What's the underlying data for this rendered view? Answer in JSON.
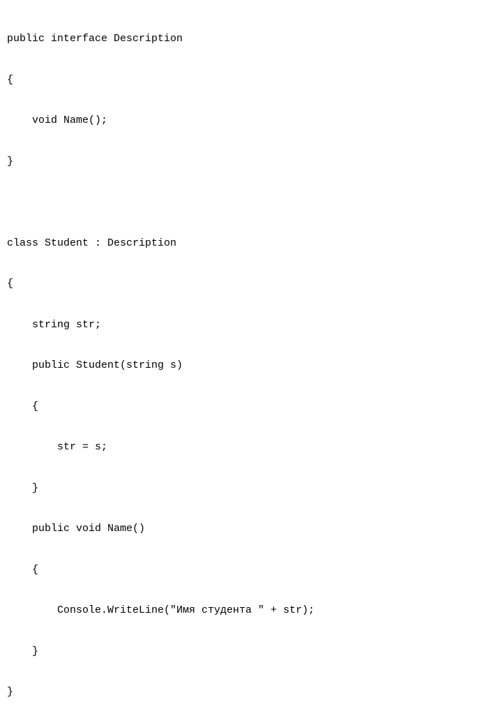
{
  "code": {
    "lines": [
      "public interface Description",
      "{",
      "    void Name();",
      "}",
      "",
      "class Student : Description",
      "{",
      "    string str;",
      "    public Student(string s)",
      "    {",
      "        str = s;",
      "    }",
      "    public void Name()",
      "    {",
      "        Console.WriteLine(\"Имя студента \" + str);",
      "    }",
      "}"
    ]
  }
}
